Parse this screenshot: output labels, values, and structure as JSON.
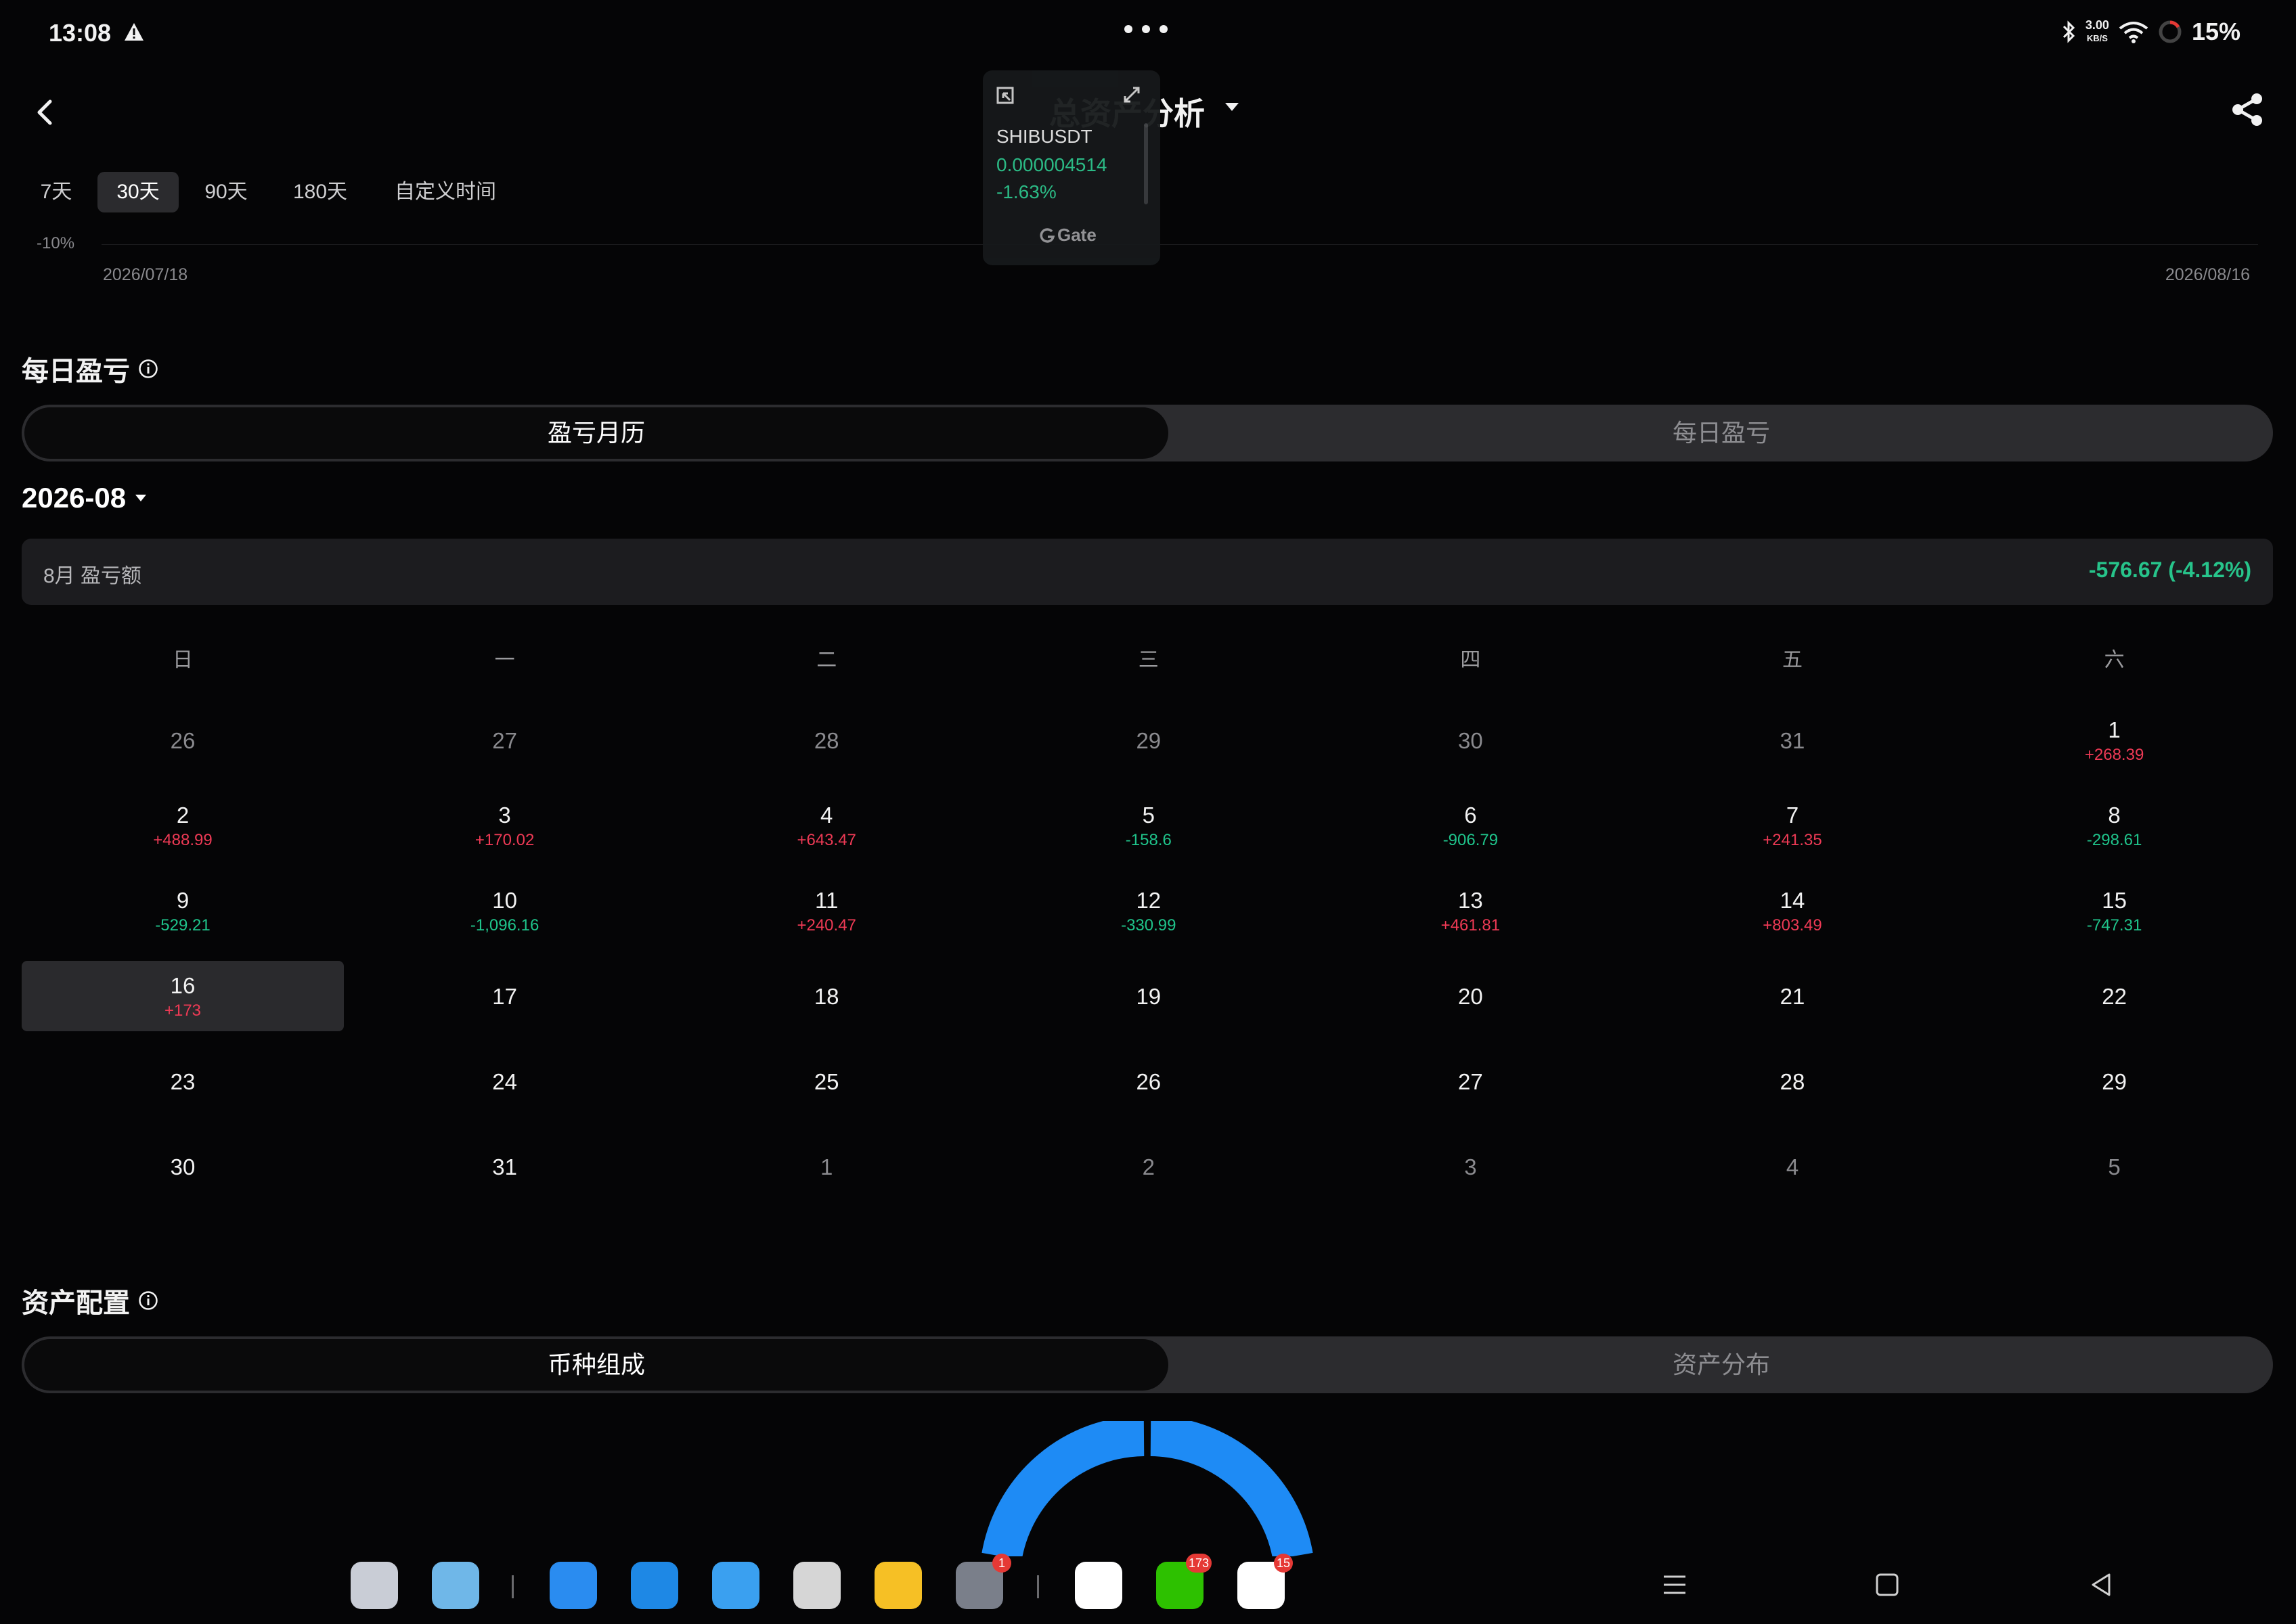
{
  "status_bar": {
    "time": "13:08",
    "net_speed_top": "3.00",
    "net_speed_unit": "KB/S",
    "battery": "15%"
  },
  "header": {
    "title": "总资产分析"
  },
  "periods": [
    "7天",
    "30天",
    "90天",
    "180天",
    "自定义时间"
  ],
  "active_period": "30天",
  "mini_chart": {
    "y_label": "-10%",
    "start_date": "2026/07/18",
    "end_date": "2026/08/16"
  },
  "float_widget": {
    "symbol": "SHIBUSDT",
    "price": "0.000004514",
    "change": "-1.63%",
    "brand": "Gate"
  },
  "daily_pnl": {
    "title": "每日盈亏",
    "tabs": {
      "active": "盈亏月历",
      "inactive": "每日盈亏"
    },
    "month": "2026-08",
    "summary_label": "8月 盈亏额",
    "summary_value": "-576.67 (-4.12%)",
    "weekdays": [
      "日",
      "一",
      "二",
      "三",
      "四",
      "五",
      "六"
    ],
    "weeks": [
      [
        {
          "d": "26",
          "m": true
        },
        {
          "d": "27",
          "m": true
        },
        {
          "d": "28",
          "m": true
        },
        {
          "d": "29",
          "m": true
        },
        {
          "d": "30",
          "m": true
        },
        {
          "d": "31",
          "m": true
        },
        {
          "d": "1",
          "v": "+268.39"
        }
      ],
      [
        {
          "d": "2",
          "v": "+488.99"
        },
        {
          "d": "3",
          "v": "+170.02"
        },
        {
          "d": "4",
          "v": "+643.47"
        },
        {
          "d": "5",
          "v": "-158.6"
        },
        {
          "d": "6",
          "v": "-906.79"
        },
        {
          "d": "7",
          "v": "+241.35"
        },
        {
          "d": "8",
          "v": "-298.61"
        }
      ],
      [
        {
          "d": "9",
          "v": "-529.21"
        },
        {
          "d": "10",
          "v": "-1,096.16"
        },
        {
          "d": "11",
          "v": "+240.47"
        },
        {
          "d": "12",
          "v": "-330.99"
        },
        {
          "d": "13",
          "v": "+461.81"
        },
        {
          "d": "14",
          "v": "+803.49"
        },
        {
          "d": "15",
          "v": "-747.31"
        }
      ],
      [
        {
          "d": "16",
          "v": "+173",
          "sel": true
        },
        {
          "d": "17"
        },
        {
          "d": "18"
        },
        {
          "d": "19"
        },
        {
          "d": "20"
        },
        {
          "d": "21"
        },
        {
          "d": "22"
        }
      ],
      [
        {
          "d": "23"
        },
        {
          "d": "24"
        },
        {
          "d": "25"
        },
        {
          "d": "26"
        },
        {
          "d": "27"
        },
        {
          "d": "28"
        },
        {
          "d": "29"
        }
      ],
      [
        {
          "d": "30"
        },
        {
          "d": "31"
        },
        {
          "d": "1",
          "m": true
        },
        {
          "d": "2",
          "m": true
        },
        {
          "d": "3",
          "m": true
        },
        {
          "d": "4",
          "m": true
        },
        {
          "d": "5",
          "m": true
        }
      ]
    ]
  },
  "allocation": {
    "title": "资产配置",
    "tabs": {
      "active": "币种组成",
      "inactive": "资产分布"
    }
  },
  "dock": {
    "apps": [
      {
        "name": "app-drawer-icon",
        "color": "#c9cdd6"
      },
      {
        "name": "files-folder-icon",
        "color": "#6fb7e8"
      },
      {
        "name": "browser-icon",
        "color": "#2a8cf0"
      },
      {
        "name": "file-manager-icon",
        "color": "#1e88e5"
      },
      {
        "name": "gallery-icon",
        "color": "#3aa0f0"
      },
      {
        "name": "camera-icon",
        "color": "#d6d6d6"
      },
      {
        "name": "notes-icon",
        "color": "#f6c025"
      },
      {
        "name": "settings-icon",
        "color": "#7a7f8a",
        "badge": "1"
      },
      {
        "name": "gate-app-icon",
        "color": "#ffffff"
      },
      {
        "name": "wechat-icon",
        "color": "#2dc100",
        "badge": "173"
      },
      {
        "name": "qq-icon",
        "color": "#ffffff",
        "badge": "15"
      }
    ]
  }
}
